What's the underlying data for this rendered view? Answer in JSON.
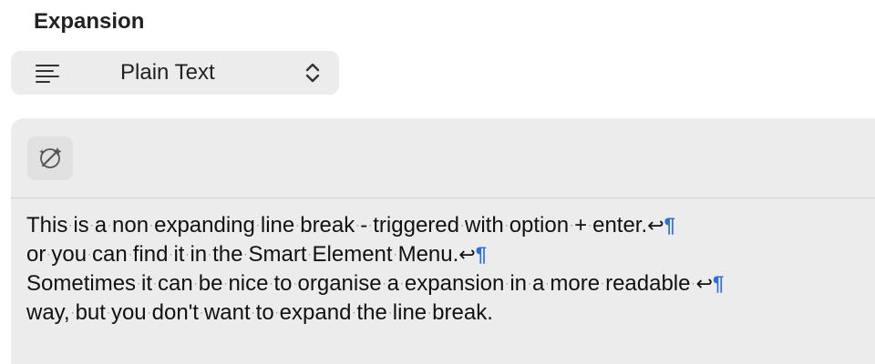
{
  "section": {
    "title": "Expansion"
  },
  "format_select": {
    "value": "Plain Text",
    "icon": "text-align-left-icon",
    "chevron_icon": "up-down-chevron-icon"
  },
  "editor": {
    "toolbar_icon": "magic-wand-sparkle-icon",
    "lines": [
      {
        "text": "This is a non expanding line break - triggered with option + enter.",
        "soft_break": true,
        "paragraph_mark": true
      },
      {
        "text": "or you can find it in the Smart Element Menu.",
        "soft_break": true,
        "paragraph_mark": true
      },
      {
        "text": "Sometimes it can be nice to organise a expansion in a more readable ",
        "soft_break": true,
        "paragraph_mark": true
      },
      {
        "text": "way, but you don't want to expand the line break.",
        "soft_break": false,
        "paragraph_mark": false
      }
    ],
    "soft_break_glyph": "↩",
    "paragraph_glyph": "¶",
    "space_marker": "·",
    "marker_color": "#2a6fdc"
  }
}
